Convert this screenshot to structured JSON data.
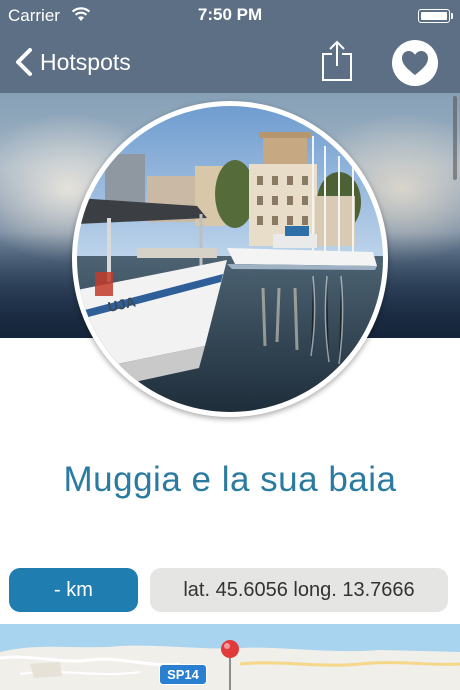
{
  "status_bar": {
    "carrier": "Carrier",
    "time": "7:50 PM"
  },
  "nav": {
    "back_label": "Hotspots"
  },
  "place": {
    "title": "Muggia e la sua baia",
    "distance": "- km",
    "coordinates": "lat. 45.6056 long. 13.7666"
  },
  "map": {
    "road_label": "SP14"
  },
  "colors": {
    "nav_bg": "#5d6f84",
    "title": "#2b7ba1",
    "distance_bg": "#1f7eaf",
    "coords_bg": "#e5e5e3",
    "pin": "#e03a3a"
  },
  "icons": [
    "wifi-icon",
    "battery-icon",
    "chevron-left-icon",
    "share-icon",
    "heart-icon",
    "map-pin-icon"
  ]
}
